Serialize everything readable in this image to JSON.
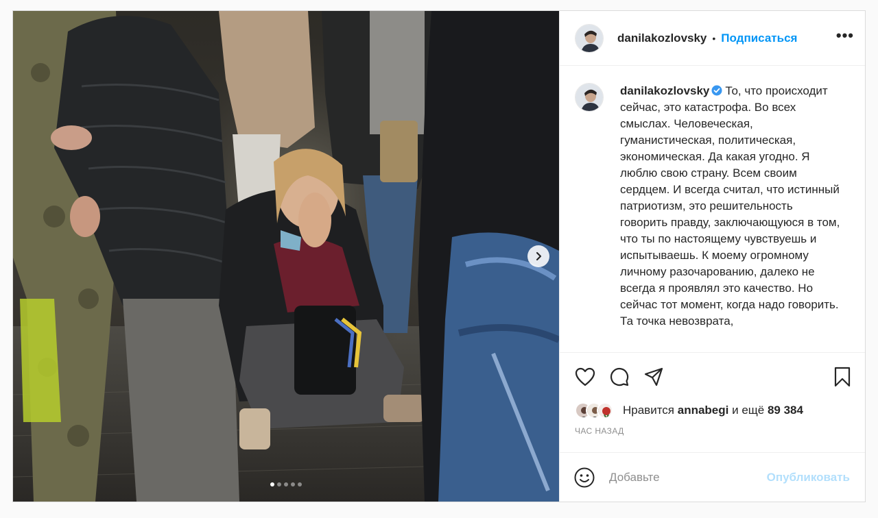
{
  "post": {
    "media": {
      "slide_count": 5,
      "active_slide": 1,
      "next_icon": "chevron-right-icon",
      "image_description_icon": "photo"
    },
    "header": {
      "username": "danilakozlovsky",
      "separator": "•",
      "follow_label": "Подписаться",
      "more_icon": "more-horizontal-icon",
      "more_label": "•••"
    },
    "caption": {
      "username": "danilakozlovsky",
      "verified_icon": "verified-badge-icon",
      "text": "То, что происходит сейчас, это катастрофа. Во всех смыслах. Человеческая, гуманистическая, политическая, экономическая. Да какая угодно. Я люблю свою страну. Всем своим сердцем. И всегда считал, что истинный патриотизм, это решительность говорить правду, заключающуюся в том, что ты по настоящему чувствуешь и испытываешь. К моему огромному личному разочарованию, далеко не всегда я проявлял это качество. Но сейчас тот момент, когда надо говорить. Та точка невозврата,"
    },
    "actions": {
      "like_icon": "heart-icon",
      "comment_icon": "comment-icon",
      "share_icon": "paper-plane-icon",
      "save_icon": "bookmark-icon"
    },
    "likes": {
      "prefix": "Нравится",
      "user": "annabegi",
      "connector": "и ещё",
      "count": "89 384"
    },
    "timestamp": "ЧАС НАЗАД",
    "comment_box": {
      "emoji_icon": "smile-icon",
      "placeholder": "Добавьте",
      "publish_label": "Опубликовать"
    },
    "colors": {
      "accent": "#0095f6",
      "publish_disabled": "#b2dffc",
      "verified": "#3897f0",
      "muted": "#8e8e8e"
    }
  }
}
